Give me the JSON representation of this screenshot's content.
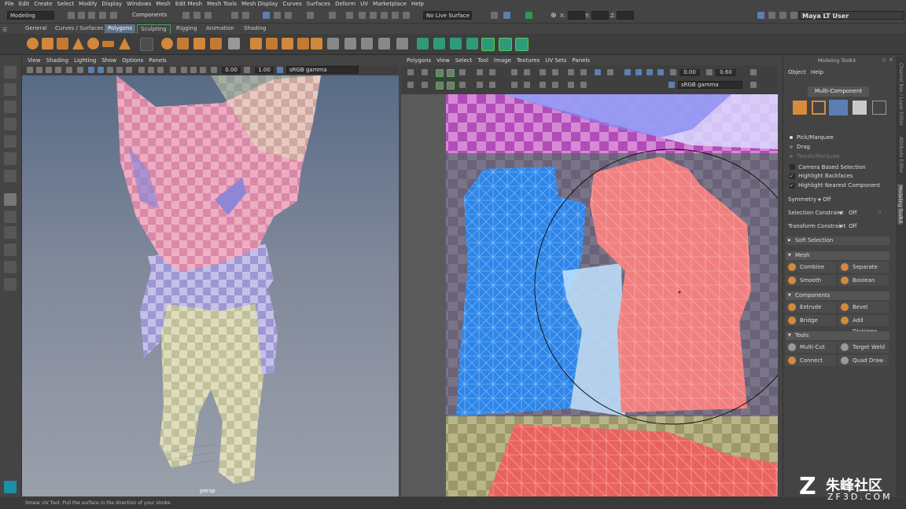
{
  "menubar": {
    "items": [
      "File",
      "Edit",
      "Create",
      "Select",
      "Modify",
      "Display",
      "Windows",
      "Mesh",
      "Edit Mesh",
      "Mesh Tools",
      "Mesh Display",
      "Curves",
      "Surfaces",
      "Deform",
      "UV",
      "Marketplace",
      "Help"
    ]
  },
  "status": {
    "workspace": "Modeling",
    "components_label": "Components",
    "live_surface": "No Live Surface",
    "x_label": "X:",
    "y_label": "Y:",
    "z_label": "Z:",
    "user": "Maya LT User"
  },
  "shelf": {
    "tabs": [
      "General",
      "Curves / Surfaces",
      "Polygons",
      "Sculpting",
      "Rigging",
      "Animation",
      "Shading"
    ],
    "active": "Polygons"
  },
  "persp_panel": {
    "menus": [
      "View",
      "Shading",
      "Lighting",
      "Show",
      "Options",
      "Panels"
    ],
    "value_a": "0.00",
    "value_b": "1.00",
    "color_space": "sRGB gamma",
    "camera_label": "persp"
  },
  "uv_panel": {
    "menus": [
      "Polygons",
      "View",
      "Select",
      "Tool",
      "Image",
      "Textures",
      "UV Sets",
      "Panels"
    ],
    "value_a": "0.00",
    "value_b": "0.60",
    "color_space": "sRGB gamma"
  },
  "toolkit": {
    "title": "Modeling Toolkit",
    "menus": [
      "Object",
      "Help"
    ],
    "mode": "Multi-Component",
    "options": [
      "Pick/Marquee",
      "Drag",
      "Tweak/Marquee"
    ],
    "checks": [
      "Camera Based Selection",
      "Highlight Backfaces",
      "Highlight Nearest Component"
    ],
    "symmetry_label": "Symmetry",
    "symmetry_value": "Off",
    "sel_constraint_label": "Selection Constraint",
    "sel_constraint_value": "Off",
    "sel_constraint_num": "0",
    "trans_constraint_label": "Transform Constraint",
    "trans_constraint_value": "Off",
    "soft_selection": "Soft Selection",
    "mesh_header": "Mesh",
    "mesh_btns": [
      "Combine",
      "Separate",
      "Smooth",
      "Boolean"
    ],
    "comp_header": "Components",
    "comp_btns": [
      "Extrude",
      "Bevel",
      "Bridge",
      "Add Divisions"
    ],
    "tools_header": "Tools",
    "tools_btns": [
      "Multi-Cut",
      "Target Weld",
      "Connect",
      "Quad Draw"
    ]
  },
  "side_tabs": [
    "Channel Box / Layer Editor",
    "Attribute Editor",
    "Modeling Toolkit"
  ],
  "help_line": "Smear UV Tool: Pull the surface in the direction of your stroke",
  "watermark": {
    "text": "朱峰社区",
    "sub": "ZF3D.COM"
  }
}
